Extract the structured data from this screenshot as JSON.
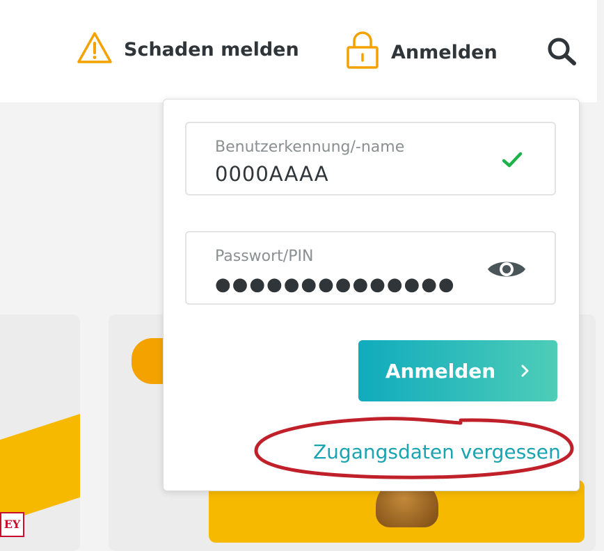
{
  "header": {
    "report_damage_label": "Schaden melden",
    "report_damage_icon": "warning-triangle-icon",
    "login_label": "Anmelden",
    "login_icon": "padlock-icon",
    "search_icon": "search-icon"
  },
  "login_popup": {
    "username": {
      "label": "Benutzerkennung/-name",
      "value": "0000AAAA",
      "status_icon": "checkmark-icon"
    },
    "password": {
      "label": "Passwort/PIN",
      "masked_value": "●●●●●●●●●●●●●●",
      "toggle_icon": "eye-icon"
    },
    "submit_label": "Anmelden",
    "submit_icon": "chevron-right-icon",
    "forgot_link": "Zugangsdaten vergessen"
  },
  "background": {
    "badge_text": "EY"
  },
  "colors": {
    "accent_orange": "#f3a200",
    "teal_start": "#10abbd",
    "teal_end": "#4ecdb8",
    "link_teal": "#1aa3b0",
    "check_green": "#1db34a",
    "annotation_red": "#c0202a"
  }
}
